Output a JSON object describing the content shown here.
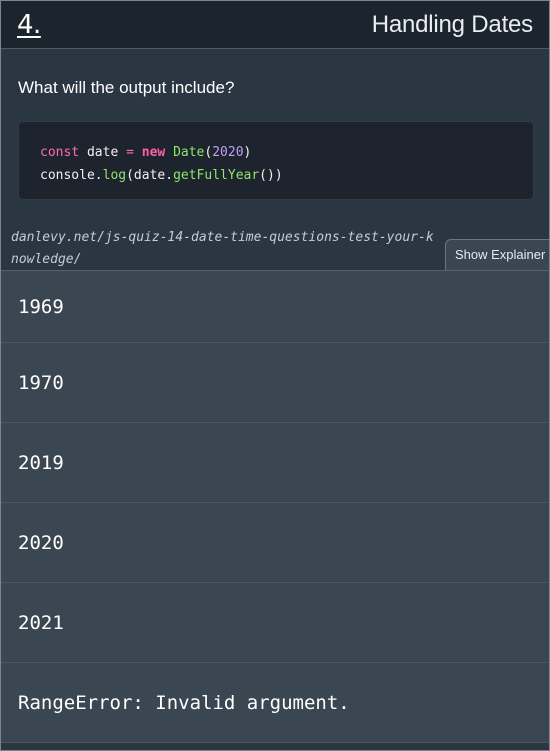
{
  "header": {
    "number": "4.",
    "title": "Handling Dates"
  },
  "question": {
    "prompt": "What will the output include?"
  },
  "code": {
    "line1": {
      "kw_const": "const",
      "var_date": " date ",
      "op_eq": "=",
      "kw_new": "new",
      "cls_date": "Date",
      "paren_open": "(",
      "num_2020": "2020",
      "paren_close": ")"
    },
    "line2": {
      "obj_console": "console.",
      "fn_log": "log",
      "arg_open": "(date.",
      "fn_getfullyear": "getFullYear",
      "arg_close": "())"
    }
  },
  "source": {
    "link": "danlevy.net/js-quiz-14-date-time-questions-test-your-knowledge/"
  },
  "explainer": {
    "label": "Show Explainer"
  },
  "answers": [
    {
      "label": "1969"
    },
    {
      "label": "1970"
    },
    {
      "label": "2019"
    },
    {
      "label": "2020"
    },
    {
      "label": "2021"
    },
    {
      "label": "RangeError: Invalid argument."
    }
  ]
}
